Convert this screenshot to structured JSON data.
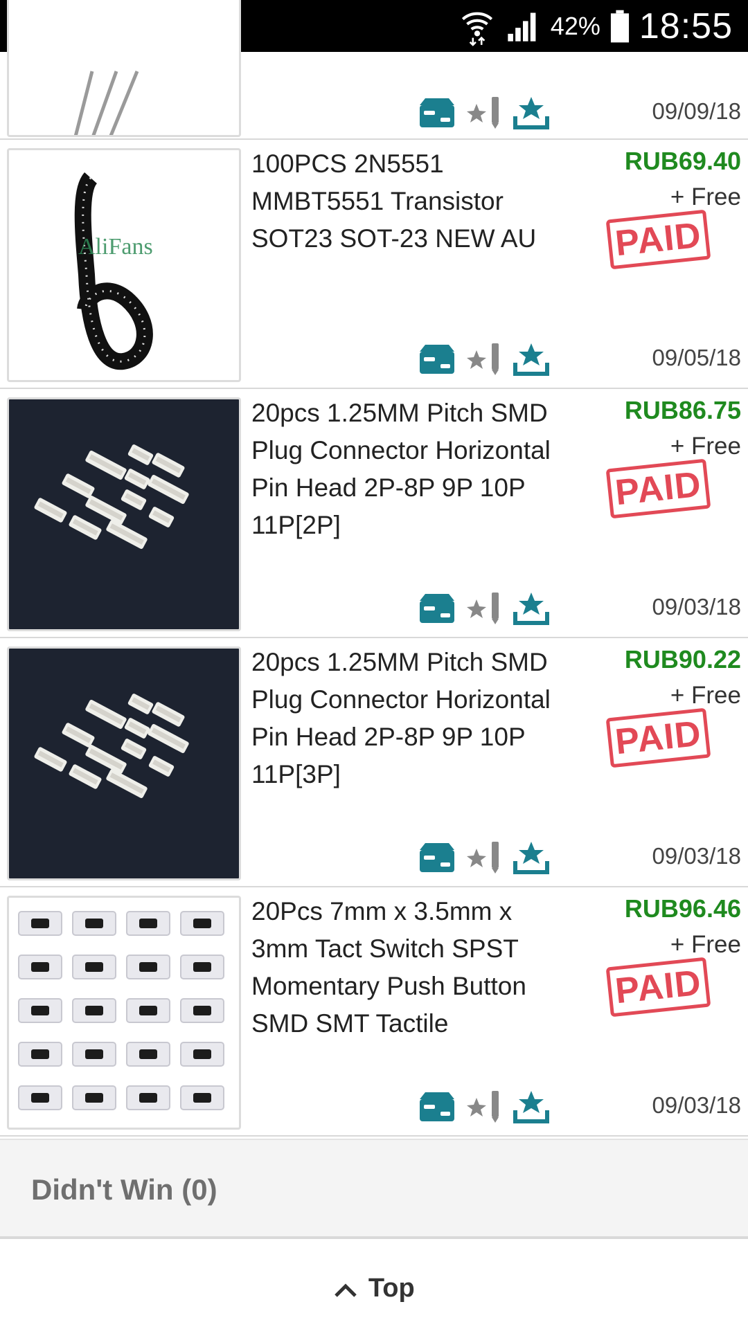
{
  "status_bar": {
    "battery_percent": "42%",
    "time": "18:55",
    "left_icons": [
      "warning-icon",
      "image-icon",
      "alert-icon"
    ],
    "right_icons": [
      "wifi-icon",
      "signal-icon",
      "battery-icon"
    ]
  },
  "colors": {
    "price_green": "#1f8a1f",
    "paid_red": "#e03a48",
    "action_teal": "#1b7f8f"
  },
  "orders": [
    {
      "title": "",
      "price": "",
      "shipping": "",
      "paid_stamp": "",
      "date": "09/09/18",
      "thumb": "wires-thumbnail"
    },
    {
      "title": "100PCS 2N5551 MMBT5551 Transistor SOT23 SOT-23 NEW AU",
      "price": "RUB69.40",
      "shipping": "+ Free",
      "paid_stamp": "PAID",
      "date": "09/05/18",
      "thumb": "tape-reel-thumbnail",
      "thumb_watermark": "AliFans"
    },
    {
      "title": "20pcs 1.25MM Pitch SMD Plug Connector Horizontal Pin Head 2P-8P 9P 10P 11P[2P]",
      "price": "RUB86.75",
      "shipping": "+ Free",
      "paid_stamp": "PAID",
      "date": "09/03/18",
      "thumb": "connectors-thumbnail"
    },
    {
      "title": "20pcs 1.25MM Pitch SMD Plug Connector Horizontal Pin Head 2P-8P 9P 10P 11P[3P]",
      "price": "RUB90.22",
      "shipping": "+ Free",
      "paid_stamp": "PAID",
      "date": "09/03/18",
      "thumb": "connectors-thumbnail"
    },
    {
      "title": "20Pcs 7mm x 3.5mm x 3mm Tact Switch SPST Momentary Push Button SMD SMT Tactile",
      "price": "RUB96.46",
      "shipping": "+ Free",
      "paid_stamp": "PAID",
      "date": "09/03/18",
      "thumb": "switches-thumbnail"
    }
  ],
  "actions": [
    "package-tracking-icon",
    "leave-feedback-icon",
    "download-icon"
  ],
  "didnt_win": {
    "label": "Didn't Win (0)"
  },
  "footer": {
    "top_label": "Top"
  }
}
